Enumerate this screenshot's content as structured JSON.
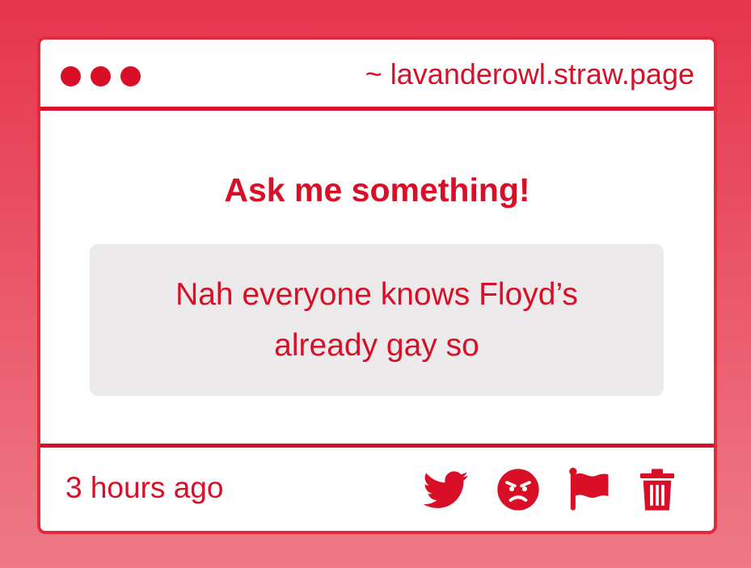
{
  "window": {
    "url": "~ lavanderowl.straw.page"
  },
  "main": {
    "heading": "Ask me something!",
    "message": "Nah everyone knows Floyd’s already gay so"
  },
  "footer": {
    "timestamp": "3 hours ago",
    "actions": [
      {
        "name": "share-twitter",
        "icon": "twitter-icon"
      },
      {
        "name": "react-angry",
        "icon": "angry-face-icon"
      },
      {
        "name": "report",
        "icon": "flag-icon"
      },
      {
        "name": "delete",
        "icon": "trash-icon"
      }
    ]
  },
  "colors": {
    "accent": "#d80f27",
    "background_top": "#e6354d",
    "background_bottom": "#ee7a87",
    "message_bg": "#eceaeb"
  }
}
